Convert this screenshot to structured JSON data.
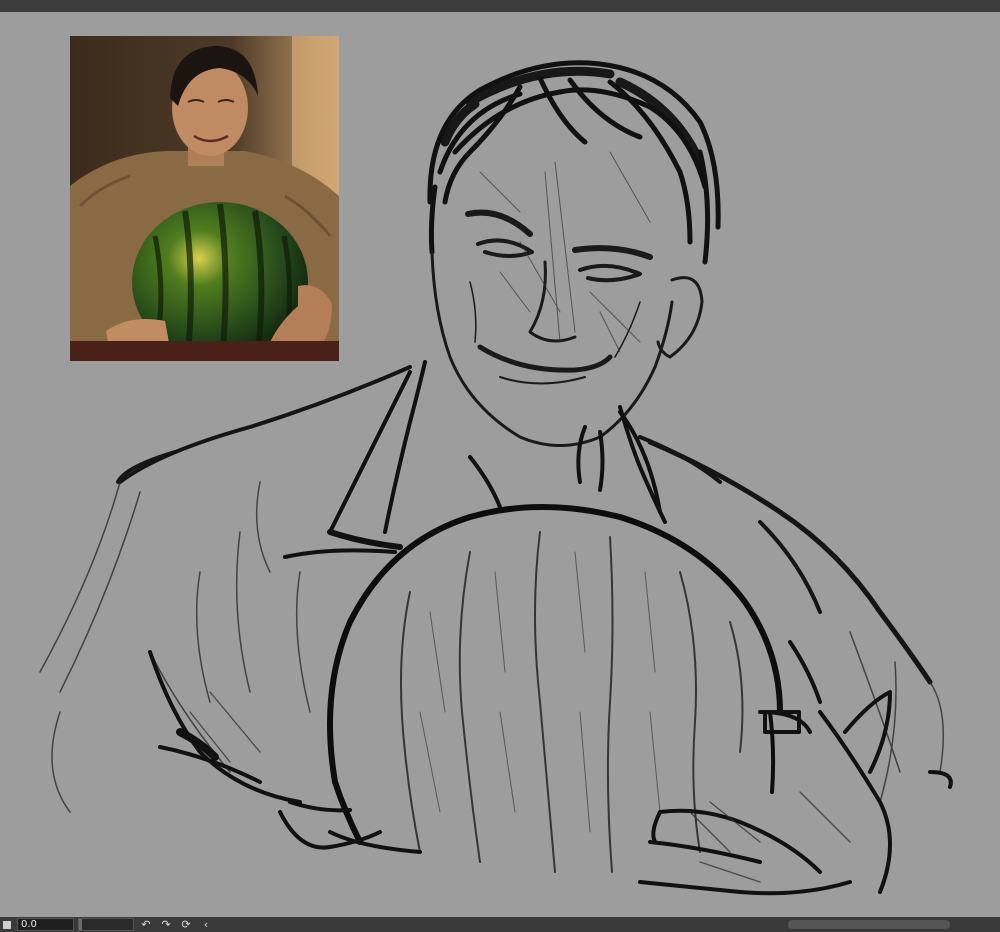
{
  "statusbar": {
    "zoom_value": "0.0",
    "zoom_fraction": 0.05,
    "buttons": [
      "rotate-left-icon",
      "rotate-right-icon",
      "reset-rotation-icon",
      "collapse-arrow-icon"
    ],
    "glyphs": {
      "rotate_left": "↶",
      "rotate_right": "↷",
      "reset": "⟳",
      "collapse": "‹"
    }
  },
  "colors": {
    "canvas": "#9d9d9d",
    "topbar": "#3d3d3d",
    "statusbar": "#3a3a3a",
    "ink": "#111111",
    "pencil": "#3a3a3a"
  }
}
